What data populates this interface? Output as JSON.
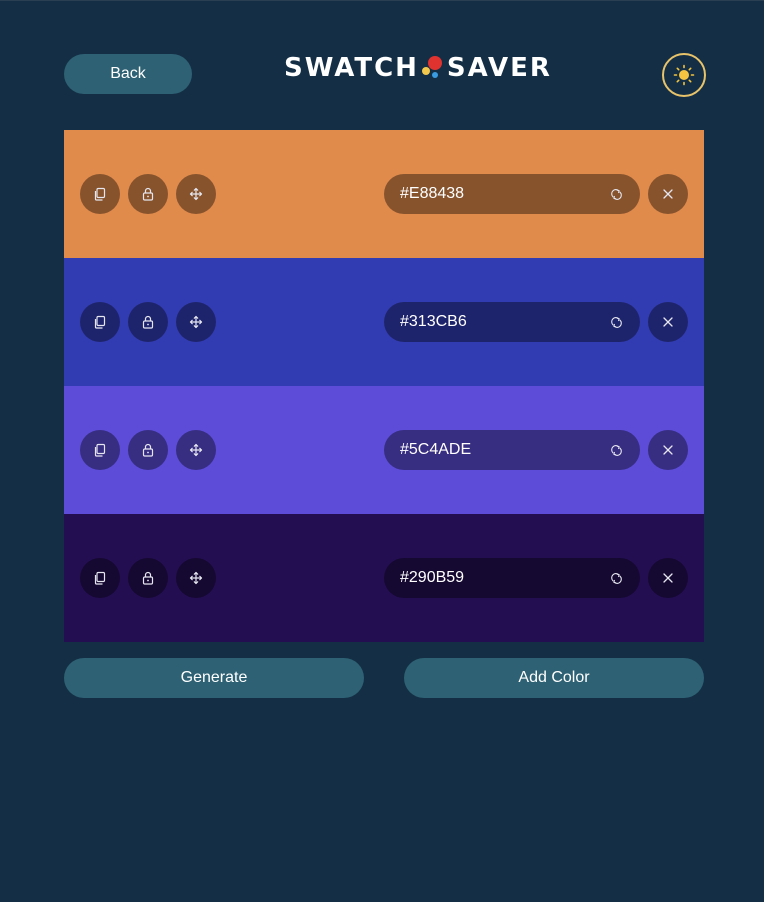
{
  "header": {
    "back_label": "Back",
    "logo_left": "SWATCH",
    "logo_right": "SAVER",
    "theme_icon": "sun-icon"
  },
  "colors": {
    "logo_dot_red": "#E0322F",
    "logo_dot_yellow": "#F2C94C",
    "logo_dot_blue": "#3A9BE0",
    "button_bg": "#2D6173",
    "page_bg": "#142F45"
  },
  "swatches": [
    {
      "hex": "#E88438",
      "color": "#E08A4C"
    },
    {
      "hex": "#313CB6",
      "color": "#323CB2"
    },
    {
      "hex": "#5C4ADE",
      "color": "#5C4CD8"
    },
    {
      "hex": "#290B59",
      "color": "#230E52"
    }
  ],
  "swatch_icons": {
    "copy": "copy-icon",
    "lock": "lock-icon",
    "move": "move-icon",
    "refresh": "refresh-icon",
    "remove": "close-icon"
  },
  "actions": {
    "generate_label": "Generate",
    "add_label": "Add Color"
  }
}
